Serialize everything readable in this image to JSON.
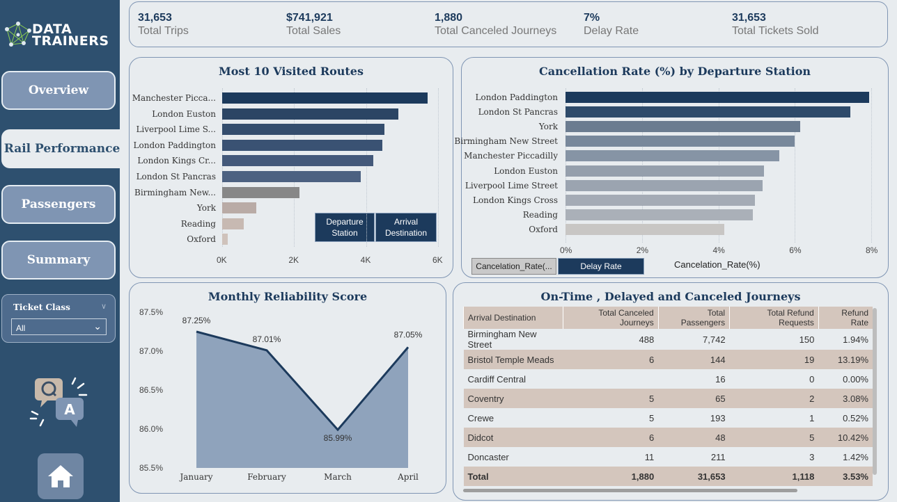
{
  "brand": {
    "line1": "DATA",
    "line2": "TRAINERS"
  },
  "nav": [
    {
      "label": "Overview"
    },
    {
      "label": "Rail Performance"
    },
    {
      "label": "Passengers"
    },
    {
      "label": "Summary"
    }
  ],
  "slicer": {
    "title": "Ticket Class",
    "value": "All"
  },
  "kpis": [
    {
      "value": "31,653",
      "label": "Total Trips"
    },
    {
      "value": "$741,921",
      "label": "Total Sales"
    },
    {
      "value": "1,880",
      "label": "Total Canceled Journeys"
    },
    {
      "value": "7%",
      "label": "Delay Rate"
    },
    {
      "value": "31,653",
      "label": "Total Tickets Sold"
    }
  ],
  "visited": {
    "title": "Most 10 Visited Routes",
    "buttons": {
      "departure": "Departure Station",
      "arrival": "Arrival Destination"
    }
  },
  "cancel": {
    "title": "Cancellation Rate (%) by Departure Station",
    "xlabel": "Cancelation_Rate(%)",
    "buttons": {
      "cancel_rate": "Cancelation_Rate(...",
      "delay_rate": "Delay Rate"
    }
  },
  "reliability": {
    "title": "Monthly Reliability Score"
  },
  "journeys": {
    "title": "On-Time , Delayed and Canceled Journeys",
    "columns": [
      "Arrival Destination",
      "Total Canceled Journeys",
      "Total Passengers",
      "Total Refund Requests",
      "Refund Rate"
    ],
    "rows": [
      [
        "Birmingham New Street",
        "488",
        "7,742",
        "150",
        "1.94%"
      ],
      [
        "Bristol Temple Meads",
        "6",
        "144",
        "19",
        "13.19%"
      ],
      [
        "Cardiff Central",
        "",
        "16",
        "0",
        "0.00%"
      ],
      [
        "Coventry",
        "5",
        "65",
        "2",
        "3.08%"
      ],
      [
        "Crewe",
        "5",
        "193",
        "1",
        "0.52%"
      ],
      [
        "Didcot",
        "6",
        "48",
        "5",
        "10.42%"
      ],
      [
        "Doncaster",
        "11",
        "211",
        "3",
        "1.42%"
      ]
    ],
    "total": [
      "Total",
      "1,880",
      "31,653",
      "1,118",
      "3.53%"
    ]
  },
  "colors": {
    "navy": "#1c3a5c",
    "sidebar": "#2e506f",
    "accent": "#7f95b3",
    "area": "#8fa3bc",
    "table_alt": "#d4c6bd"
  },
  "chart_data": [
    {
      "type": "bar",
      "orientation": "horizontal",
      "title": "Most 10 Visited Routes",
      "categories": [
        "Manchester Picca...",
        "London Euston",
        "Liverpool Lime S...",
        "London Paddington",
        "London Kings Cr...",
        "London St Pancras",
        "Birmingham New...",
        "York",
        "Reading",
        "Oxford"
      ],
      "values": [
        5700,
        4900,
        4500,
        4450,
        4200,
        3850,
        2150,
        950,
        600,
        150
      ],
      "xticks": [
        "0K",
        "2K",
        "4K",
        "6K"
      ],
      "xlim": [
        0,
        6000
      ]
    },
    {
      "type": "bar",
      "orientation": "horizontal",
      "title": "Cancellation Rate (%) by Departure Station",
      "categories": [
        "London Paddington",
        "London St Pancras",
        "York",
        "Birmingham New Street",
        "Manchester Piccadilly",
        "London Euston",
        "Liverpool Lime Street",
        "London Kings Cross",
        "Reading",
        "Oxford"
      ],
      "values": [
        7.95,
        7.45,
        6.15,
        6.0,
        5.6,
        5.2,
        5.15,
        4.95,
        4.9,
        4.15
      ],
      "xticks": [
        "0%",
        "2%",
        "4%",
        "6%",
        "8%"
      ],
      "xlim": [
        0,
        8
      ],
      "xlabel": "Cancelation_Rate(%)"
    },
    {
      "type": "area",
      "title": "Monthly Reliability Score",
      "categories": [
        "January",
        "February",
        "March",
        "April"
      ],
      "values": [
        87.25,
        87.01,
        85.99,
        87.05
      ],
      "labels": [
        "87.25%",
        "87.01%",
        "85.99%",
        "87.05%"
      ],
      "yticks": [
        "87.5%",
        "87.0%",
        "86.5%",
        "86.0%",
        "85.5%"
      ],
      "ylim": [
        85.5,
        87.5
      ]
    }
  ]
}
